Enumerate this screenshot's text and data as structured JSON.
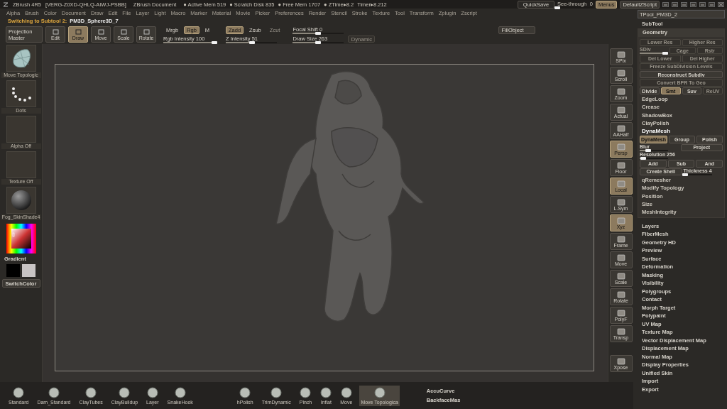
{
  "title_bar": {
    "app": "ZBrush 4R5",
    "serial": "[VERG-Z0XD-QHLQ-AIWJ-PSBB]",
    "document": "ZBrush Document",
    "stats": [
      "● Active Mem 519",
      "● Scratch Disk 835",
      "● Free Mem 1707",
      "● ZTime▸8.2",
      "Timer▸8.212"
    ],
    "quicksave": "QuickSave",
    "see_through": {
      "label": "See-through",
      "value": "0",
      "level": 0
    },
    "buttons": [
      {
        "label": "Menus",
        "selected": true
      },
      {
        "label": "DefaultZScript",
        "selected": false
      }
    ]
  },
  "menu": [
    "Alpha",
    "Brush",
    "Color",
    "Document",
    "Draw",
    "Edit",
    "File",
    "Layer",
    "Light",
    "Macro",
    "Marker",
    "Material",
    "Movie",
    "Picker",
    "Preferences",
    "Render",
    "Stencil",
    "Stroke",
    "Texture",
    "Tool",
    "Transform",
    "Zplugin",
    "Zscript"
  ],
  "status": {
    "message": "Switching to Subtool 2:",
    "subtool": "PM3D_Sphere3D_7"
  },
  "shelf": {
    "projection_master": "Projection Master",
    "modes": [
      {
        "label": "Edit",
        "selected": false
      },
      {
        "label": "Draw",
        "selected": true
      },
      {
        "label": "Move",
        "selected": false
      },
      {
        "label": "Scale",
        "selected": false
      },
      {
        "label": "Rotate",
        "selected": false
      }
    ],
    "rgb_modes": [
      {
        "label": "Mrgb",
        "selected": false
      },
      {
        "label": "Rgb",
        "selected": true
      },
      {
        "label": "M",
        "selected": false
      }
    ],
    "rgb_intensity": {
      "label": "Rgb Intensity 100",
      "level": 1
    },
    "z_modes": [
      {
        "label": "Zadd",
        "selected": true,
        "disabled": false
      },
      {
        "label": "Zsub",
        "selected": false,
        "disabled": false
      },
      {
        "label": "Zcut",
        "selected": false,
        "disabled": true
      }
    ],
    "z_intensity": {
      "label": "Z Intensity 51",
      "level": 0.51
    },
    "focal_shift": {
      "label": "Focal Shift 0",
      "level": 0.5
    },
    "draw_size": {
      "label": "Draw Size 263",
      "level": 0.5
    },
    "dynamic": {
      "label": "Dynamic",
      "disabled": true
    },
    "fill_object": "FillObject"
  },
  "left_shelf": {
    "thumbnails": [
      {
        "kind": "brush",
        "label": "Move Topologic"
      },
      {
        "kind": "stroke",
        "label": "Dots"
      },
      {
        "kind": "empty",
        "label": "Alpha Off"
      },
      {
        "kind": "empty",
        "label": "Texture Off"
      },
      {
        "kind": "material",
        "label": "Fog_SkinShade4"
      }
    ],
    "gradient": "Gradient",
    "swatches": [
      {
        "color": "#000000"
      },
      {
        "color": "#c8c4c4"
      }
    ],
    "switch_color": "SwitchColor"
  },
  "right_shelf": [
    {
      "label": "SPix",
      "selected": false
    },
    {
      "label": "Scroll",
      "selected": false
    },
    {
      "label": "Zoom",
      "selected": false
    },
    {
      "label": "Actual",
      "selected": false
    },
    {
      "label": "AAHalf",
      "selected": false
    },
    {
      "label": "Persp",
      "selected": true
    },
    {
      "label": "Floor",
      "selected": false
    },
    {
      "label": "Local",
      "selected": true
    },
    {
      "label": "L.Sym",
      "selected": false
    },
    {
      "label": "Xyz",
      "selected": true
    },
    {
      "label": "Frame",
      "selected": false
    },
    {
      "label": "Move",
      "selected": false
    },
    {
      "label": "Scale",
      "selected": false
    },
    {
      "label": "Rotate",
      "selected": false
    },
    {
      "label": "PolyF",
      "selected": false
    },
    {
      "label": "Transp",
      "selected": false
    },
    {
      "label": "Xpose",
      "selected": false
    }
  ],
  "tool_panel": {
    "tool_name": "TPool_PM3D_2",
    "subtool": "SubTool",
    "geometry": "Geometry",
    "rows": [
      [
        {
          "kind": "button",
          "label": "Lower Res",
          "on": false,
          "disabled": true
        },
        {
          "kind": "button",
          "label": "Higher Res",
          "on": false,
          "disabled": true
        }
      ],
      [
        {
          "kind": "slider",
          "label": "SDiv",
          "level": 0.9,
          "disabled": true
        },
        {
          "kind": "button",
          "label": "Cage",
          "on": false,
          "disabled": true
        },
        {
          "kind": "button",
          "label": "Rstr",
          "on": false,
          "disabled": true
        }
      ],
      [
        {
          "kind": "button",
          "label": "Del Lower",
          "on": false,
          "disabled": true
        },
        {
          "kind": "button",
          "label": "Del Higher",
          "on": false,
          "disabled": true
        }
      ],
      [
        {
          "kind": "button",
          "label": "Freeze SubDivision Levels",
          "on": false,
          "disabled": true
        }
      ],
      [
        {
          "kind": "button",
          "label": "Reconstruct Subdiv",
          "on": false,
          "disabled": false
        }
      ],
      [
        {
          "kind": "button",
          "label": "Convert BPR To Geo",
          "on": false,
          "disabled": true
        }
      ],
      [
        {
          "kind": "button",
          "label": "Divide",
          "on": false,
          "disabled": false
        },
        {
          "kind": "button",
          "label": "Smt",
          "on": true,
          "disabled": false
        },
        {
          "kind": "button",
          "label": "Suv",
          "on": false,
          "disabled": false
        },
        {
          "kind": "button",
          "label": "ReUV",
          "on": false,
          "disabled": true
        }
      ],
      [
        {
          "kind": "heading",
          "label": "EdgeLoop",
          "expanded": false
        }
      ],
      [
        {
          "kind": "heading",
          "label": "Crease",
          "expanded": false
        }
      ],
      [
        {
          "kind": "heading",
          "label": "ShadowBox",
          "expanded": false
        }
      ],
      [
        {
          "kind": "heading",
          "label": "ClayPolish",
          "expanded": false
        }
      ],
      [
        {
          "kind": "heading",
          "label": "DynaMesh",
          "expanded": true
        }
      ],
      [
        {
          "kind": "button",
          "label": "DynaMesh",
          "on": true,
          "disabled": false
        },
        {
          "kind": "button",
          "label": "Group",
          "on": false,
          "disabled": false
        },
        {
          "kind": "button",
          "label": "Polish",
          "on": false,
          "disabled": false
        }
      ],
      [
        {
          "kind": "slider",
          "label": "Blur",
          "level": 0.3,
          "disabled": false
        },
        {
          "kind": "button",
          "label": "Project",
          "on": false,
          "disabled": false
        }
      ],
      [
        {
          "kind": "slider",
          "label": "Resolution 256",
          "level": 0.12,
          "disabled": false
        }
      ],
      [
        {
          "kind": "button",
          "label": "Add",
          "on": false,
          "disabled": false
        },
        {
          "kind": "button",
          "label": "Sub",
          "on": false,
          "disabled": false
        },
        {
          "kind": "button",
          "label": "And",
          "on": false,
          "disabled": false
        }
      ],
      [
        {
          "kind": "button",
          "label": "Create Shell",
          "on": false,
          "disabled": false
        },
        {
          "kind": "slider",
          "label": "Thickness 4",
          "level": 0.05,
          "disabled": false
        }
      ],
      [
        {
          "kind": "heading",
          "label": "qRemesher",
          "expanded": false
        }
      ],
      [
        {
          "kind": "heading",
          "label": "Modify Topology",
          "expanded": false
        }
      ],
      [
        {
          "kind": "heading",
          "label": "Position",
          "expanded": false
        }
      ],
      [
        {
          "kind": "heading",
          "label": "Size",
          "expanded": false
        }
      ],
      [
        {
          "kind": "heading",
          "label": "MeshIntegrity",
          "expanded": false
        }
      ]
    ],
    "sections": [
      "Layers",
      "FiberMesh",
      "Geometry HD",
      "Preview",
      "Surface",
      "Deformation",
      "Masking",
      "Visibility",
      "Polygroups",
      "Contact",
      "Morph Target",
      "Polypaint",
      "UV Map",
      "Texture Map",
      "Vector Displacement Map",
      "Displacement Map",
      "Normal Map",
      "Display Properties",
      "Unified Skin",
      "Import",
      "Export"
    ]
  },
  "bottom_shelf": {
    "brushes": [
      {
        "label": "Standard",
        "selected": false
      },
      {
        "label": "Dam_Standard",
        "selected": false
      },
      {
        "label": "ClayTubes",
        "selected": false
      },
      {
        "label": "ClayBuildup",
        "selected": false
      },
      {
        "label": "Layer",
        "selected": false
      },
      {
        "label": "SnakeHook",
        "selected": false
      },
      {
        "label": "hPolish",
        "selected": false
      },
      {
        "label": "TrimDynamic",
        "selected": false
      },
      {
        "label": "Pinch",
        "selected": false
      },
      {
        "label": "Inflat",
        "selected": false
      },
      {
        "label": "Move",
        "selected": false
      },
      {
        "label": "Move Topologica",
        "selected": true
      }
    ],
    "toggles": [
      "AccuCurve",
      "BackfaceMas"
    ]
  }
}
